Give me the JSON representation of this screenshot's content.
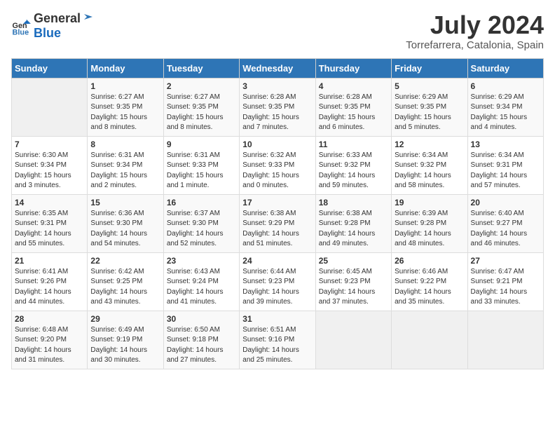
{
  "logo": {
    "general": "General",
    "blue": "Blue"
  },
  "header": {
    "month_year": "July 2024",
    "location": "Torrefarrera, Catalonia, Spain"
  },
  "weekdays": [
    "Sunday",
    "Monday",
    "Tuesday",
    "Wednesday",
    "Thursday",
    "Friday",
    "Saturday"
  ],
  "weeks": [
    [
      {
        "day": "",
        "info": ""
      },
      {
        "day": "1",
        "info": "Sunrise: 6:27 AM\nSunset: 9:35 PM\nDaylight: 15 hours\nand 8 minutes."
      },
      {
        "day": "2",
        "info": "Sunrise: 6:27 AM\nSunset: 9:35 PM\nDaylight: 15 hours\nand 8 minutes."
      },
      {
        "day": "3",
        "info": "Sunrise: 6:28 AM\nSunset: 9:35 PM\nDaylight: 15 hours\nand 7 minutes."
      },
      {
        "day": "4",
        "info": "Sunrise: 6:28 AM\nSunset: 9:35 PM\nDaylight: 15 hours\nand 6 minutes."
      },
      {
        "day": "5",
        "info": "Sunrise: 6:29 AM\nSunset: 9:35 PM\nDaylight: 15 hours\nand 5 minutes."
      },
      {
        "day": "6",
        "info": "Sunrise: 6:29 AM\nSunset: 9:34 PM\nDaylight: 15 hours\nand 4 minutes."
      }
    ],
    [
      {
        "day": "7",
        "info": "Sunrise: 6:30 AM\nSunset: 9:34 PM\nDaylight: 15 hours\nand 3 minutes."
      },
      {
        "day": "8",
        "info": "Sunrise: 6:31 AM\nSunset: 9:34 PM\nDaylight: 15 hours\nand 2 minutes."
      },
      {
        "day": "9",
        "info": "Sunrise: 6:31 AM\nSunset: 9:33 PM\nDaylight: 15 hours\nand 1 minute."
      },
      {
        "day": "10",
        "info": "Sunrise: 6:32 AM\nSunset: 9:33 PM\nDaylight: 15 hours\nand 0 minutes."
      },
      {
        "day": "11",
        "info": "Sunrise: 6:33 AM\nSunset: 9:32 PM\nDaylight: 14 hours\nand 59 minutes."
      },
      {
        "day": "12",
        "info": "Sunrise: 6:34 AM\nSunset: 9:32 PM\nDaylight: 14 hours\nand 58 minutes."
      },
      {
        "day": "13",
        "info": "Sunrise: 6:34 AM\nSunset: 9:31 PM\nDaylight: 14 hours\nand 57 minutes."
      }
    ],
    [
      {
        "day": "14",
        "info": "Sunrise: 6:35 AM\nSunset: 9:31 PM\nDaylight: 14 hours\nand 55 minutes."
      },
      {
        "day": "15",
        "info": "Sunrise: 6:36 AM\nSunset: 9:30 PM\nDaylight: 14 hours\nand 54 minutes."
      },
      {
        "day": "16",
        "info": "Sunrise: 6:37 AM\nSunset: 9:30 PM\nDaylight: 14 hours\nand 52 minutes."
      },
      {
        "day": "17",
        "info": "Sunrise: 6:38 AM\nSunset: 9:29 PM\nDaylight: 14 hours\nand 51 minutes."
      },
      {
        "day": "18",
        "info": "Sunrise: 6:38 AM\nSunset: 9:28 PM\nDaylight: 14 hours\nand 49 minutes."
      },
      {
        "day": "19",
        "info": "Sunrise: 6:39 AM\nSunset: 9:28 PM\nDaylight: 14 hours\nand 48 minutes."
      },
      {
        "day": "20",
        "info": "Sunrise: 6:40 AM\nSunset: 9:27 PM\nDaylight: 14 hours\nand 46 minutes."
      }
    ],
    [
      {
        "day": "21",
        "info": "Sunrise: 6:41 AM\nSunset: 9:26 PM\nDaylight: 14 hours\nand 44 minutes."
      },
      {
        "day": "22",
        "info": "Sunrise: 6:42 AM\nSunset: 9:25 PM\nDaylight: 14 hours\nand 43 minutes."
      },
      {
        "day": "23",
        "info": "Sunrise: 6:43 AM\nSunset: 9:24 PM\nDaylight: 14 hours\nand 41 minutes."
      },
      {
        "day": "24",
        "info": "Sunrise: 6:44 AM\nSunset: 9:23 PM\nDaylight: 14 hours\nand 39 minutes."
      },
      {
        "day": "25",
        "info": "Sunrise: 6:45 AM\nSunset: 9:23 PM\nDaylight: 14 hours\nand 37 minutes."
      },
      {
        "day": "26",
        "info": "Sunrise: 6:46 AM\nSunset: 9:22 PM\nDaylight: 14 hours\nand 35 minutes."
      },
      {
        "day": "27",
        "info": "Sunrise: 6:47 AM\nSunset: 9:21 PM\nDaylight: 14 hours\nand 33 minutes."
      }
    ],
    [
      {
        "day": "28",
        "info": "Sunrise: 6:48 AM\nSunset: 9:20 PM\nDaylight: 14 hours\nand 31 minutes."
      },
      {
        "day": "29",
        "info": "Sunrise: 6:49 AM\nSunset: 9:19 PM\nDaylight: 14 hours\nand 30 minutes."
      },
      {
        "day": "30",
        "info": "Sunrise: 6:50 AM\nSunset: 9:18 PM\nDaylight: 14 hours\nand 27 minutes."
      },
      {
        "day": "31",
        "info": "Sunrise: 6:51 AM\nSunset: 9:16 PM\nDaylight: 14 hours\nand 25 minutes."
      },
      {
        "day": "",
        "info": ""
      },
      {
        "day": "",
        "info": ""
      },
      {
        "day": "",
        "info": ""
      }
    ]
  ]
}
